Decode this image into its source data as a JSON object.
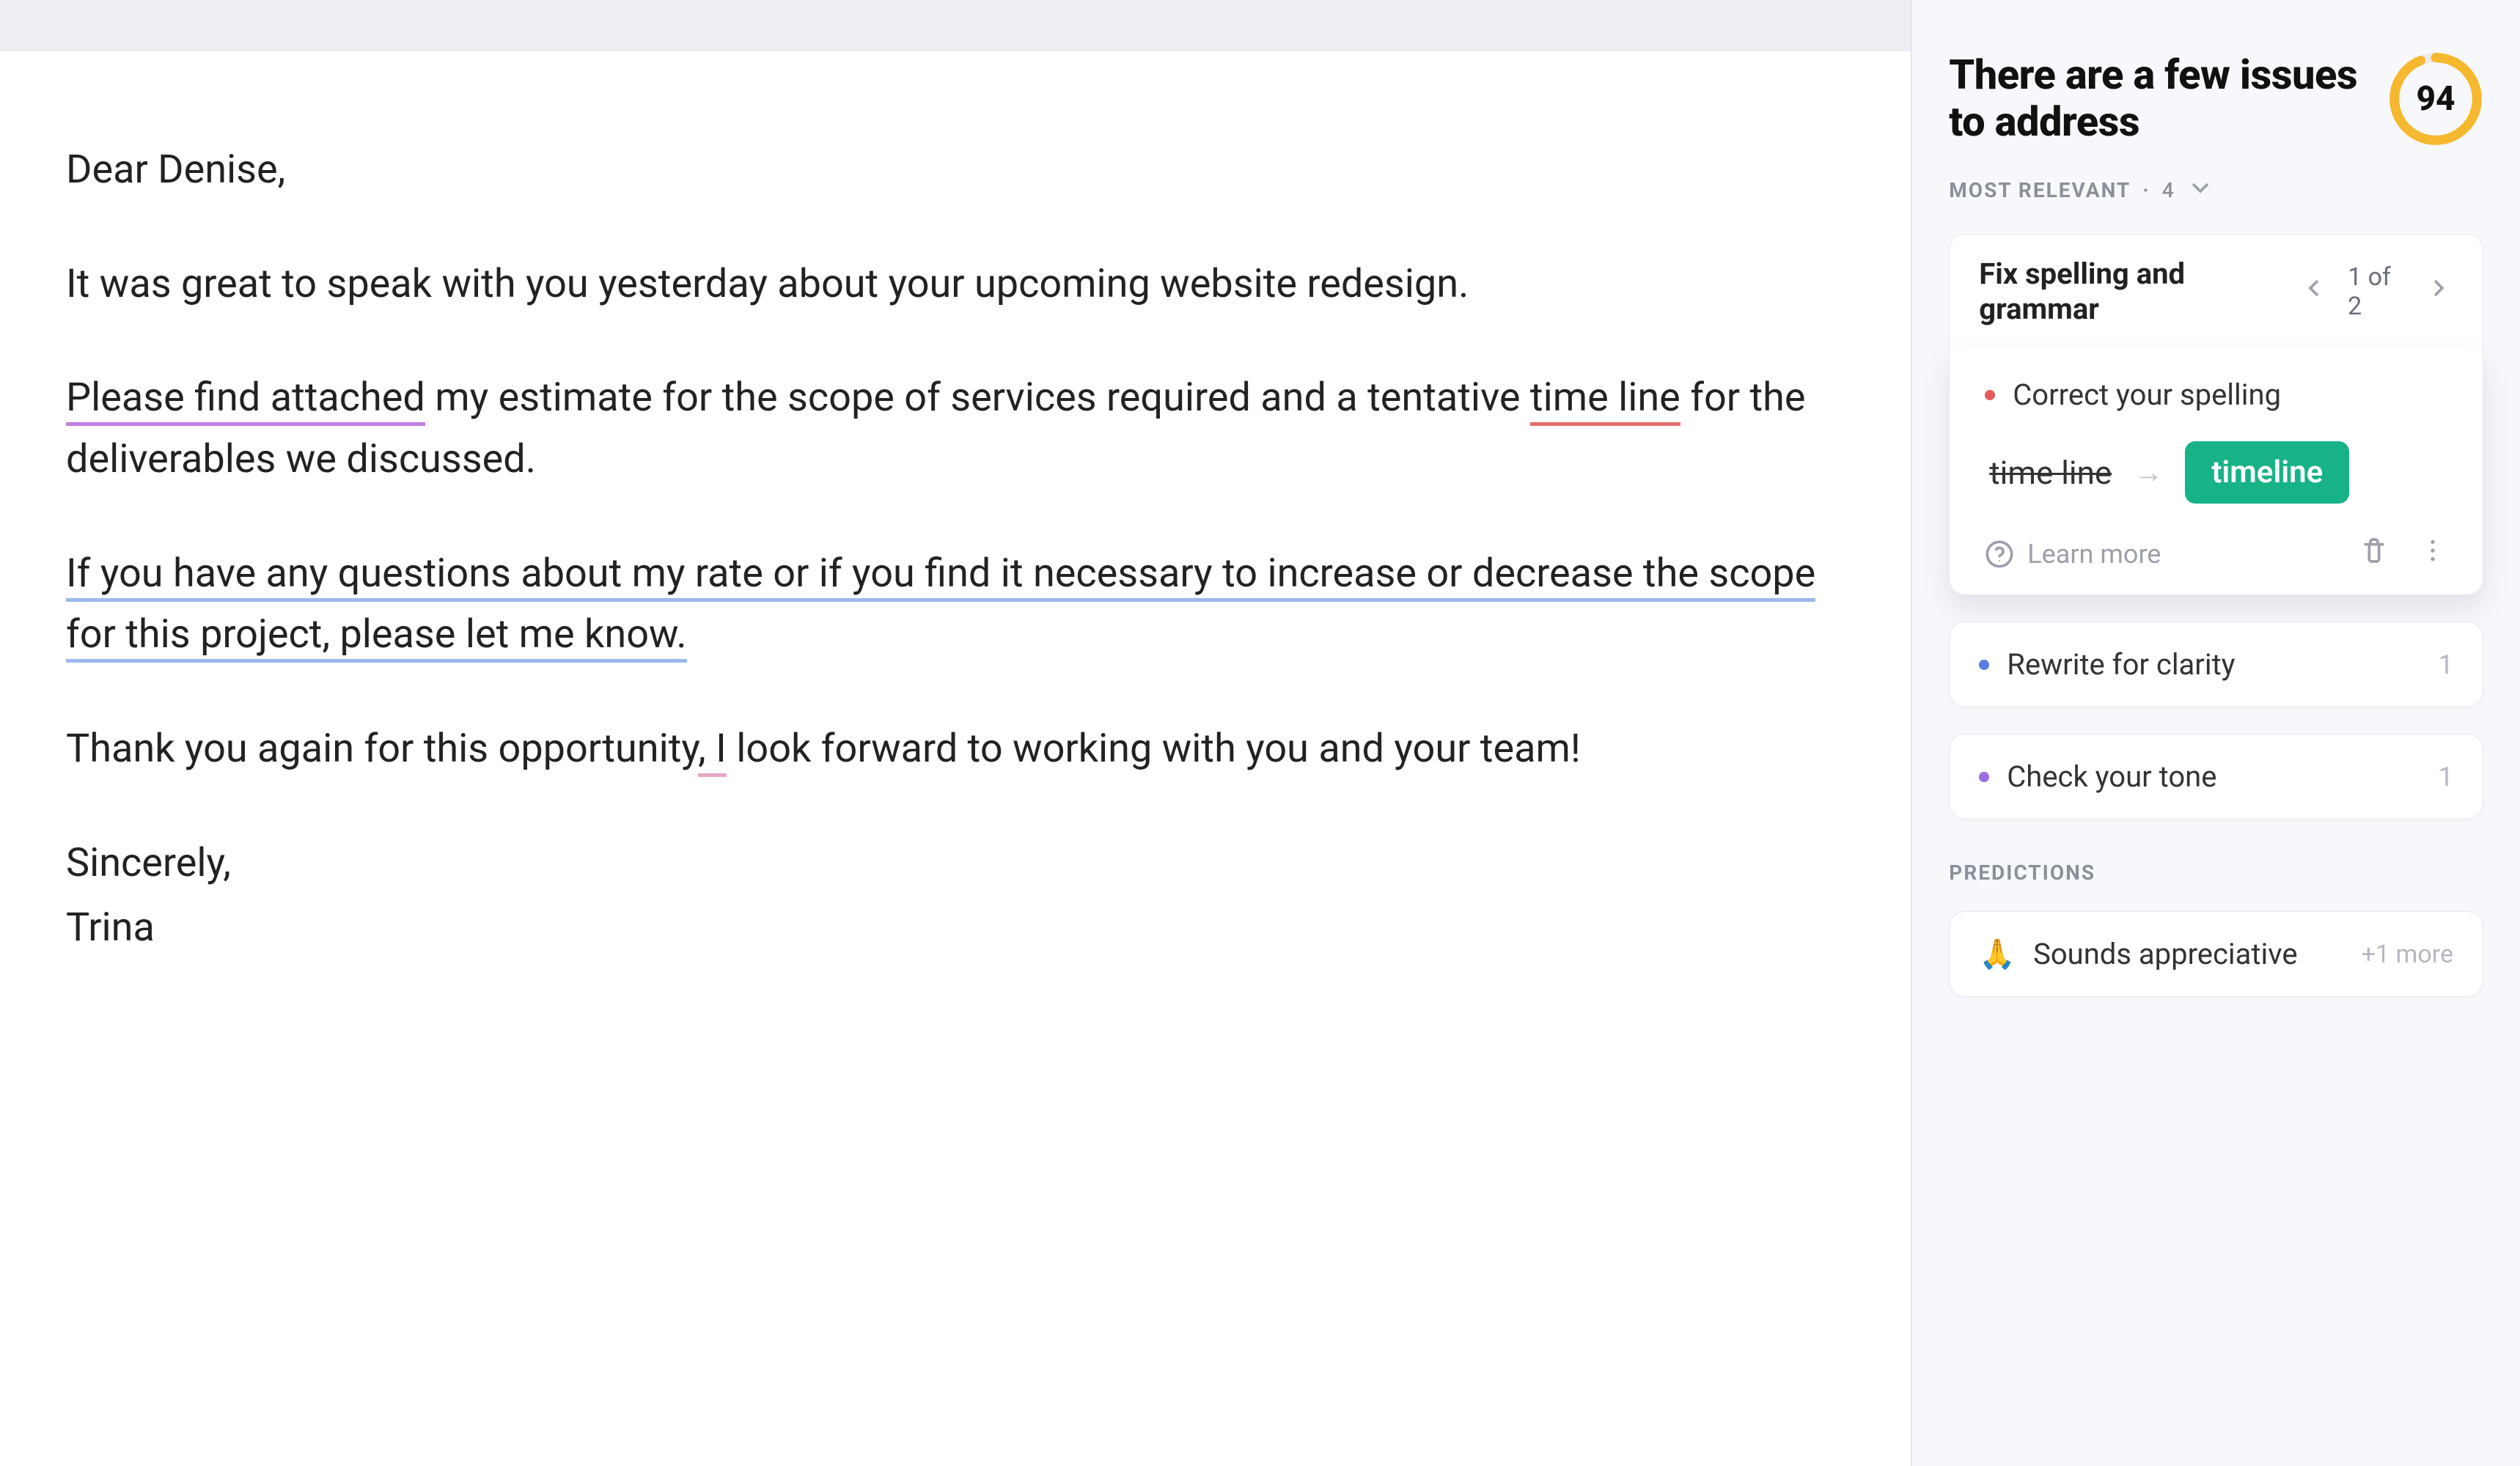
{
  "editor": {
    "greeting": "Dear Denise,",
    "para1": "It was great to speak with you yesterday about your upcoming website redesign.",
    "para2": {
      "seg_purple": "Please find attached",
      "seg_after_purple": " my estimate for the scope of services required and a tentative ",
      "seg_red": "time line",
      "seg_after_red": " for the deliverables we discussed."
    },
    "para3": {
      "seg_blue": "If you have any questions about my rate or if you find it necessary to increase or decrease the scope for this project, please let me know."
    },
    "para4": {
      "pre": "Thank you again for this opportunity",
      "pink": ", I",
      "post": " look forward to working with you and your team!"
    },
    "sign1": "Sincerely,",
    "sign2": "Trina"
  },
  "sidebar": {
    "title": "There are a few issues to address",
    "score": "94",
    "most_relevant_label": "MOST RELEVANT",
    "most_relevant_count": "4",
    "group": {
      "title": "Fix spelling and grammar",
      "pager_text": "1 of 2"
    },
    "suggestion": {
      "title": "Correct your spelling",
      "original": "time line",
      "replacement": "timeline",
      "learn_more": "Learn more"
    },
    "collapsed": [
      {
        "dot": "blue",
        "label": "Rewrite for clarity",
        "count": "1"
      },
      {
        "dot": "purple",
        "label": "Check your tone",
        "count": "1"
      }
    ],
    "predictions_label": "PREDICTIONS",
    "prediction": {
      "emoji": "🙏",
      "label": "Sounds appreciative",
      "more": "+1 more"
    }
  }
}
